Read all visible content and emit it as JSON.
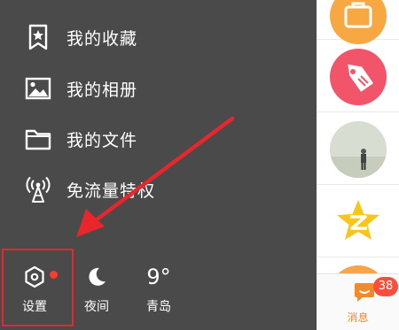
{
  "drawer": {
    "menu": [
      {
        "label": "我的收藏",
        "icon": "bookmark-star-icon"
      },
      {
        "label": "我的相册",
        "icon": "picture-icon"
      },
      {
        "label": "我的文件",
        "icon": "folder-icon"
      },
      {
        "label": "免流量特权",
        "icon": "antenna-signal-icon"
      }
    ],
    "toolbar": {
      "settings_label": "设置",
      "night_label": "夜间",
      "weather_temp": "9°",
      "weather_city": "青岛"
    }
  },
  "right_panel": {
    "messages_tab_label": "消息",
    "messages_badge": "38"
  },
  "colors": {
    "drawer_bg": "#4a4a4a",
    "highlight": "#e8262b",
    "accent_orange": "#f08a2b",
    "badge_red": "#ff4d3d"
  }
}
